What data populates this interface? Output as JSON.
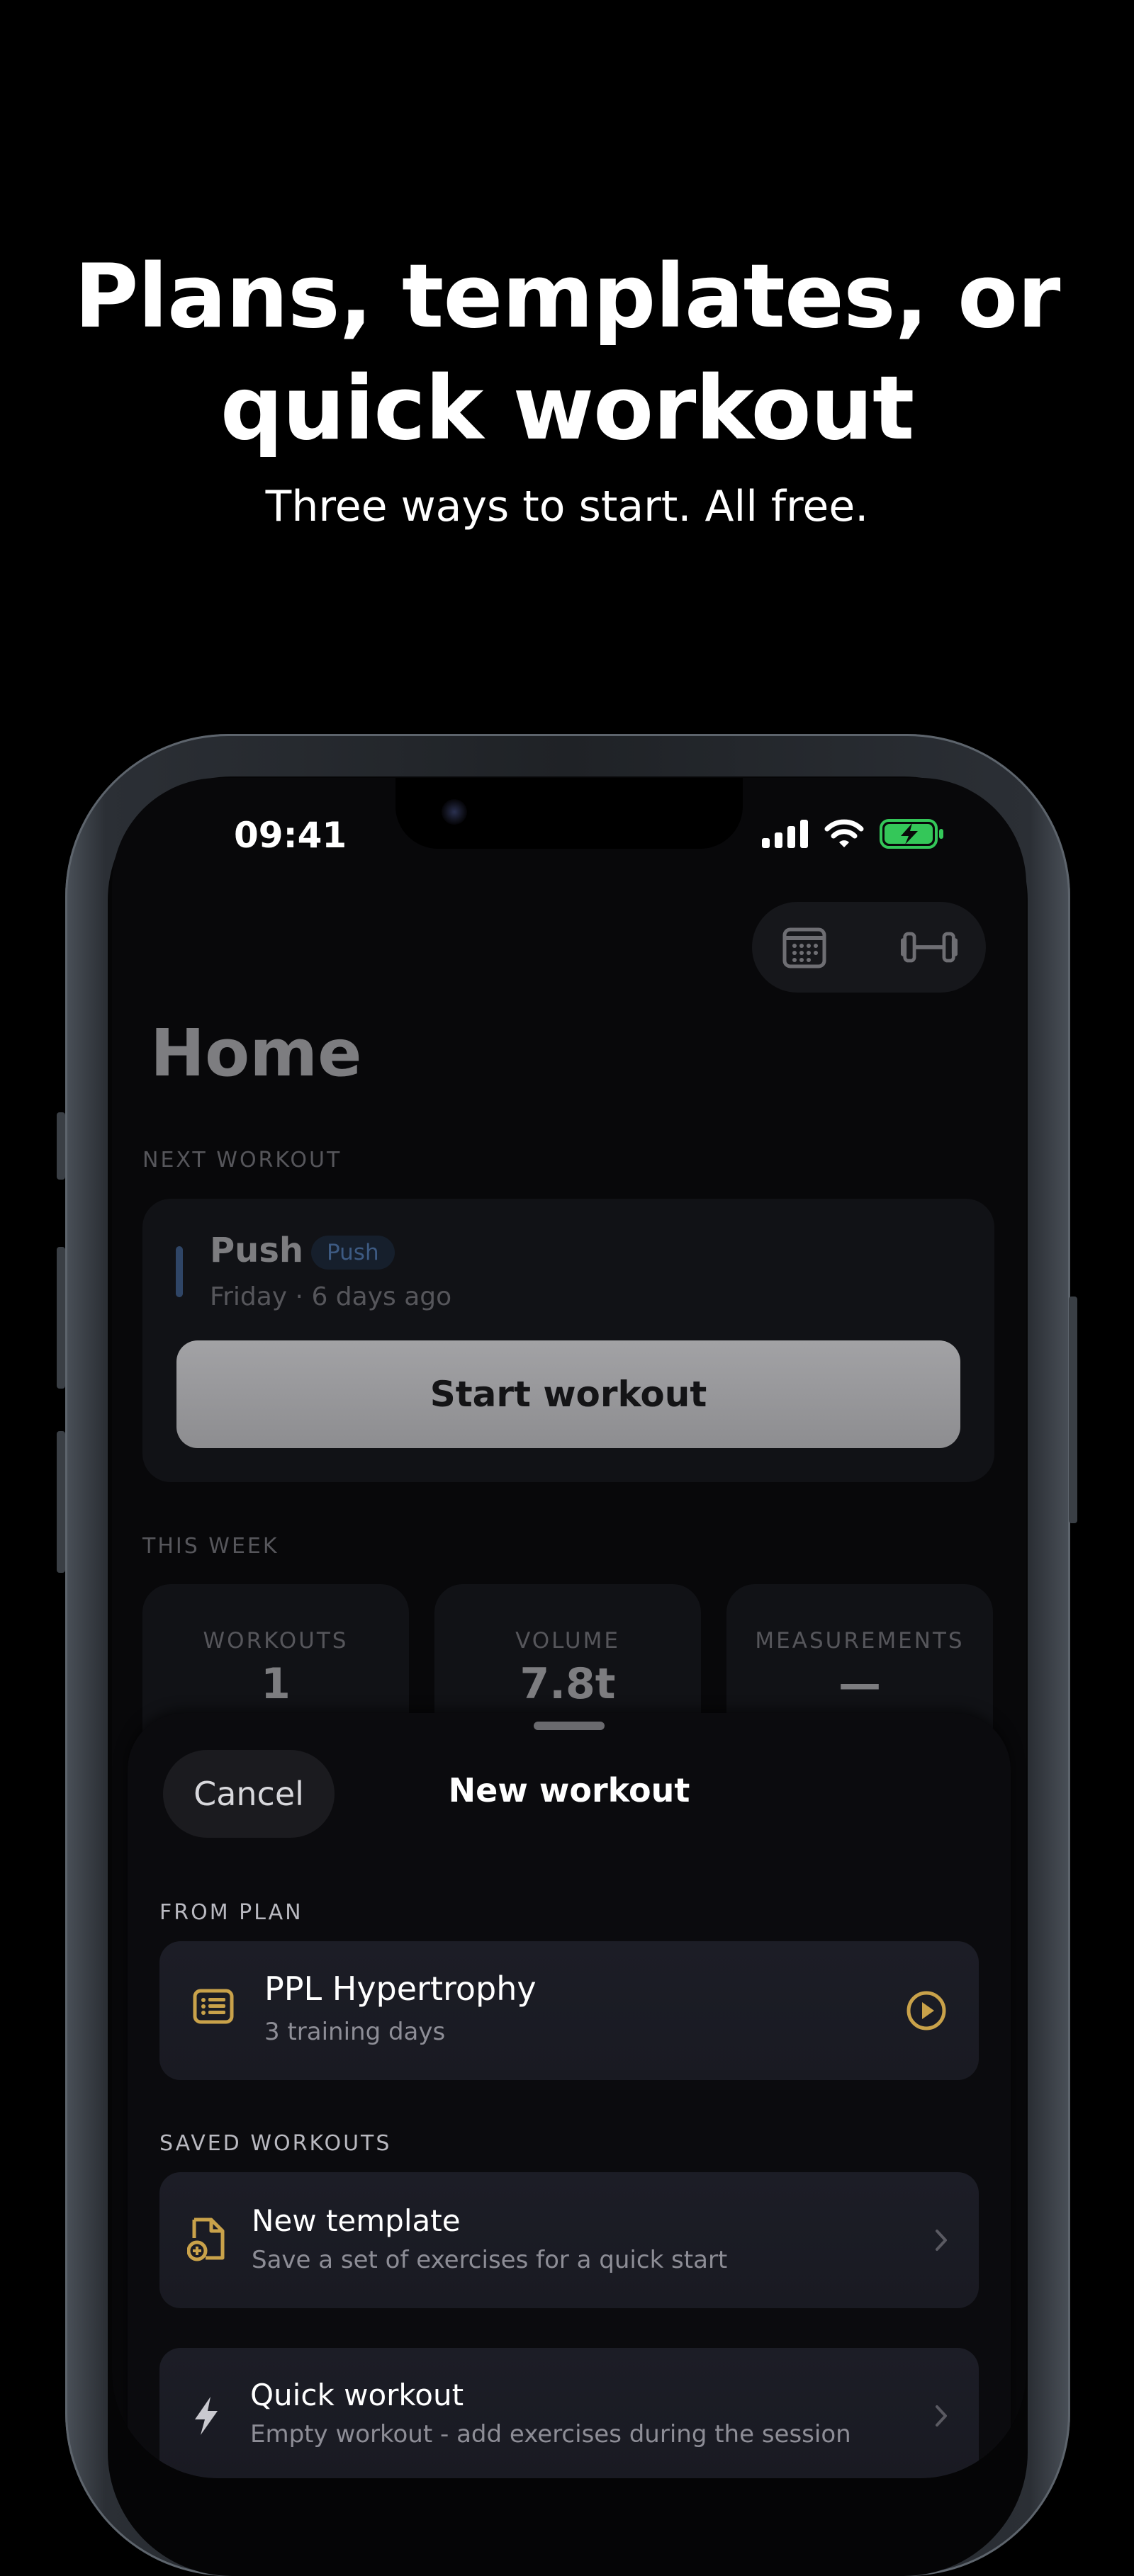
{
  "hero": {
    "headline_line1": "Plans, templates, or",
    "headline_line2": "quick workout",
    "subheadline": "Three ways to start. All free."
  },
  "status_bar": {
    "time": "09:41"
  },
  "home": {
    "title": "Home",
    "toolbar": {
      "calendar_icon": "calendar-icon",
      "dumbbell_icon": "dumbbell-icon"
    },
    "next_workout": {
      "section_label": "NEXT WORKOUT",
      "name": "Push",
      "badge": "Push",
      "subtitle": "Friday · 6 days ago",
      "start_button": "Start workout"
    },
    "this_week": {
      "section_label": "THIS WEEK",
      "stats": [
        {
          "label": "WORKOUTS",
          "value": "1"
        },
        {
          "label": "VOLUME",
          "value": "7.8t"
        },
        {
          "label": "MEASUREMENTS",
          "value": "—"
        }
      ]
    }
  },
  "sheet": {
    "cancel_label": "Cancel",
    "title": "New workout",
    "from_plan": {
      "section_label": "FROM PLAN",
      "plan_title": "PPL Hypertrophy",
      "plan_subtitle": "3 training days"
    },
    "saved_workouts": {
      "section_label": "SAVED WORKOUTS",
      "items": [
        {
          "title": "New template",
          "subtitle": "Save a set of exercises for a quick start"
        },
        {
          "title": "Quick workout",
          "subtitle": "Empty workout - add exercises during the session"
        }
      ]
    }
  },
  "colors": {
    "accent_gold": "#c9a24a",
    "background": "#000000",
    "card": "#1c1d26"
  }
}
